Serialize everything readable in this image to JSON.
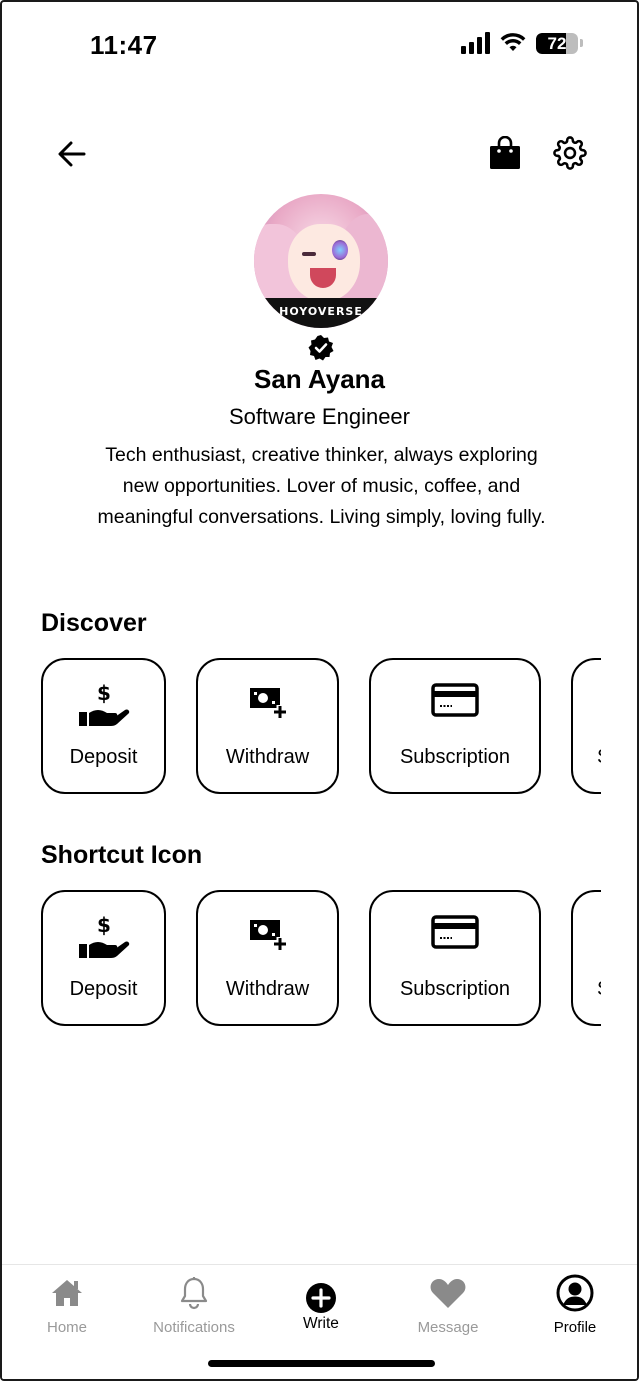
{
  "status_bar": {
    "time": "11:47",
    "battery": "72",
    "battery_level": 0.72
  },
  "header": {
    "back_icon": "arrow-left-icon",
    "bag_icon": "shopping-bag-icon",
    "settings_icon": "gear-icon"
  },
  "profile": {
    "avatar_brand": "HOYOVERSE",
    "name": "San Ayana",
    "role": "Software Engineer",
    "bio": "Tech enthusiast, creative thinker, always exploring new opportunities. Lover of music, coffee, and meaningful conversations. Living simply, loving fully."
  },
  "discover": {
    "title": "Discover",
    "items": [
      {
        "label": "Deposit",
        "icon": "hand-dollar-icon"
      },
      {
        "label": "Withdraw",
        "icon": "cash-plus-icon"
      },
      {
        "label": "Subscription",
        "icon": "credit-card-icon"
      },
      {
        "label": "S",
        "icon": ""
      }
    ]
  },
  "shortcut": {
    "title": "Shortcut Icon",
    "items": [
      {
        "label": "Deposit",
        "icon": "hand-dollar-icon"
      },
      {
        "label": "Withdraw",
        "icon": "cash-plus-icon"
      },
      {
        "label": "Subscription",
        "icon": "credit-card-icon"
      },
      {
        "label": "S",
        "icon": ""
      }
    ]
  },
  "tabbar": {
    "items": [
      {
        "label": "Home",
        "icon": "home-icon"
      },
      {
        "label": "Notifications",
        "icon": "bell-icon"
      },
      {
        "label": "Write",
        "icon": "plus-circle-icon"
      },
      {
        "label": "Message",
        "icon": "heart-icon"
      },
      {
        "label": "Profile",
        "icon": "user-circle-icon"
      }
    ],
    "active": "Profile"
  },
  "colors": {
    "text": "#000000",
    "inactive": "#9a9a9a",
    "inactive_icon": "#8a8a8a",
    "border": "#000000"
  }
}
